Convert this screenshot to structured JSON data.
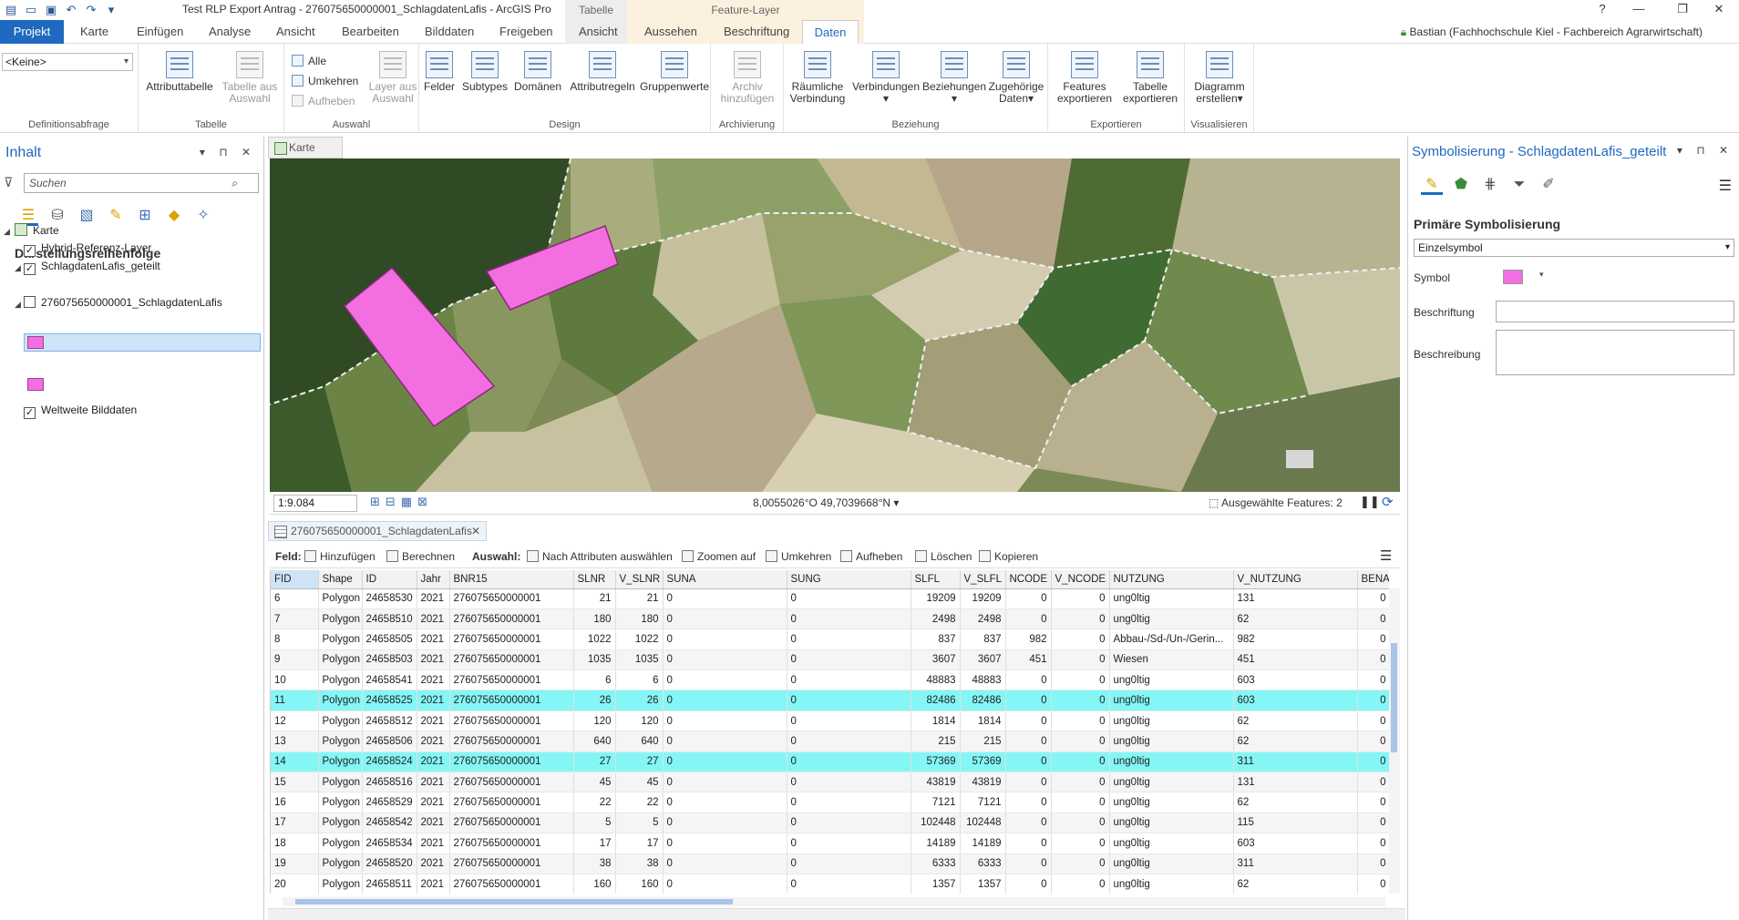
{
  "app": {
    "title": "Test RLP Export Antrag - 276075650000001_SchlagdatenLafis - ArcGIS Pro",
    "ctx_group1": "Tabelle",
    "ctx_group2": "Feature-Layer",
    "user": "Bastian (Fachhochschule Kiel - Fachbereich Agrarwirtschaft)",
    "help": "?",
    "min": "—",
    "max": "❐",
    "close": "✕"
  },
  "tabs": [
    "Projekt",
    "Karte",
    "Einfügen",
    "Analyse",
    "Ansicht",
    "Bearbeiten",
    "Bilddaten",
    "Freigeben",
    "Ansicht",
    "Aussehen",
    "Beschriftung",
    "Daten"
  ],
  "ribbon": {
    "defq_value": "<Keine>",
    "groups": {
      "definitionsabfrage": "Definitionsabfrage",
      "tabelle": "Tabelle",
      "auswahl": "Auswahl",
      "design": "Design",
      "archivierung": "Archivierung",
      "beziehung": "Beziehung",
      "exportieren": "Exportieren",
      "visualisieren": "Visualisieren"
    },
    "attributtabelle": "Attributtabelle",
    "tabelle_aus_auswahl_1": "Tabelle aus",
    "tabelle_aus_auswahl_2": "Auswahl",
    "alle": "Alle",
    "umkehren": "Umkehren",
    "aufheben": "Aufheben",
    "layer_aus_auswahl_1": "Layer aus",
    "layer_aus_auswahl_2": "Auswahl",
    "felder": "Felder",
    "subtypes": "Subtypes",
    "domaenen": "Domänen",
    "attributregeln": "Attributregeln",
    "gruppenwerte": "Gruppenwerte",
    "archiv_1": "Archiv",
    "archiv_2": "hinzufügen",
    "raeumliche_1": "Räumliche",
    "raeumliche_2": "Verbindung",
    "verbindungen": "Verbindungen",
    "beziehungen": "Beziehungen",
    "zugehoerige_1": "Zugehörige",
    "zugehoerige_2": "Daten",
    "features_1": "Features",
    "features_2": "exportieren",
    "tabelle_exp_1": "Tabelle",
    "tabelle_exp_2": "exportieren",
    "diagramm_1": "Diagramm",
    "diagramm_2": "erstellen"
  },
  "contents": {
    "title": "Inhalt",
    "search_placeholder": "Suchen",
    "order": "Darstellungsreihenfolge",
    "map": "Karte",
    "layers": [
      "Hybrid-Referenz-Layer",
      "SchlagdatenLafis_geteilt",
      "276075650000001_SchlagdatenLafis",
      "Weltweite Bilddaten"
    ]
  },
  "map": {
    "tab": "Karte",
    "scale": "1:9.084",
    "coords": "8,0055026°O 49,7039668°N",
    "selected": "Ausgewählte Features: 2"
  },
  "table": {
    "tab": "276075650000001_SchlagdatenLafis",
    "feld": "Feld:",
    "hinzufuegen": "Hinzufügen",
    "berechnen": "Berechnen",
    "auswahl": "Auswahl:",
    "nach_attr": "Nach Attributen auswählen",
    "zoomen": "Zoomen auf",
    "umkehren": "Umkehren",
    "aufheben": "Aufheben",
    "loeschen": "Löschen",
    "kopieren": "Kopieren",
    "columns": [
      "FID",
      "Shape",
      "ID",
      "Jahr",
      "BNR15",
      "SLNR",
      "V_SLNR",
      "SUNA",
      "SUNG",
      "SLFL",
      "V_SLFL",
      "NCODE",
      "V_NCODE",
      "NUTZUNG",
      "V_NUTZUNG",
      "BENA"
    ],
    "rows": [
      [
        "6",
        "Polygon",
        "24658530",
        "2021",
        "276075650000001",
        "21",
        "21",
        "0",
        "0",
        "19209",
        "19209",
        "0",
        "0",
        "ung0ltig",
        "131",
        "0"
      ],
      [
        "7",
        "Polygon",
        "24658510",
        "2021",
        "276075650000001",
        "180",
        "180",
        "0",
        "0",
        "2498",
        "2498",
        "0",
        "0",
        "ung0ltig",
        "62",
        "0"
      ],
      [
        "8",
        "Polygon",
        "24658505",
        "2021",
        "276075650000001",
        "1022",
        "1022",
        "0",
        "0",
        "837",
        "837",
        "982",
        "0",
        "Abbau-/Sd-/Un-/Gerin...",
        "982",
        "0"
      ],
      [
        "9",
        "Polygon",
        "24658503",
        "2021",
        "276075650000001",
        "1035",
        "1035",
        "0",
        "0",
        "3607",
        "3607",
        "451",
        "0",
        "Wiesen",
        "451",
        "0"
      ],
      [
        "10",
        "Polygon",
        "24658541",
        "2021",
        "276075650000001",
        "6",
        "6",
        "0",
        "0",
        "48883",
        "48883",
        "0",
        "0",
        "ung0ltig",
        "603",
        "0"
      ],
      [
        "11",
        "Polygon",
        "24658525",
        "2021",
        "276075650000001",
        "26",
        "26",
        "0",
        "0",
        "82486",
        "82486",
        "0",
        "0",
        "ung0ltig",
        "603",
        "0"
      ],
      [
        "12",
        "Polygon",
        "24658512",
        "2021",
        "276075650000001",
        "120",
        "120",
        "0",
        "0",
        "1814",
        "1814",
        "0",
        "0",
        "ung0ltig",
        "62",
        "0"
      ],
      [
        "13",
        "Polygon",
        "24658506",
        "2021",
        "276075650000001",
        "640",
        "640",
        "0",
        "0",
        "215",
        "215",
        "0",
        "0",
        "ung0ltig",
        "62",
        "0"
      ],
      [
        "14",
        "Polygon",
        "24658524",
        "2021",
        "276075650000001",
        "27",
        "27",
        "0",
        "0",
        "57369",
        "57369",
        "0",
        "0",
        "ung0ltig",
        "311",
        "0"
      ],
      [
        "15",
        "Polygon",
        "24658516",
        "2021",
        "276075650000001",
        "45",
        "45",
        "0",
        "0",
        "43819",
        "43819",
        "0",
        "0",
        "ung0ltig",
        "131",
        "0"
      ],
      [
        "16",
        "Polygon",
        "24658529",
        "2021",
        "276075650000001",
        "22",
        "22",
        "0",
        "0",
        "7121",
        "7121",
        "0",
        "0",
        "ung0ltig",
        "62",
        "0"
      ],
      [
        "17",
        "Polygon",
        "24658542",
        "2021",
        "276075650000001",
        "5",
        "5",
        "0",
        "0",
        "102448",
        "102448",
        "0",
        "0",
        "ung0ltig",
        "115",
        "0"
      ],
      [
        "18",
        "Polygon",
        "24658534",
        "2021",
        "276075650000001",
        "17",
        "17",
        "0",
        "0",
        "14189",
        "14189",
        "0",
        "0",
        "ung0ltig",
        "603",
        "0"
      ],
      [
        "19",
        "Polygon",
        "24658520",
        "2021",
        "276075650000001",
        "38",
        "38",
        "0",
        "0",
        "6333",
        "6333",
        "0",
        "0",
        "ung0ltig",
        "311",
        "0"
      ],
      [
        "20",
        "Polygon",
        "24658511",
        "2021",
        "276075650000001",
        "160",
        "160",
        "0",
        "0",
        "1357",
        "1357",
        "0",
        "0",
        "ung0ltig",
        "62",
        "0"
      ]
    ],
    "selected_fids": [
      "11",
      "14"
    ]
  },
  "symbology": {
    "title": "Symbolisierung - SchlagdatenLafis_geteilt",
    "primary": "Primäre Symbolisierung",
    "type": "Einzelsymbol",
    "symbol": "Symbol",
    "label": "Beschriftung",
    "desc": "Beschreibung",
    "menu": "☰"
  },
  "colors": {
    "accent": "#1f69c0",
    "selection": "#84f6f6",
    "symbol": "#f36ee0"
  }
}
